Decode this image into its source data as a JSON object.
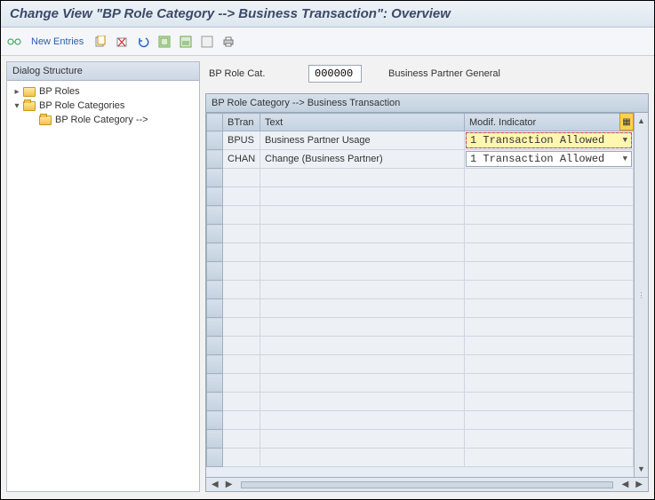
{
  "title": "Change View \"BP Role Category --> Business Transaction\": Overview",
  "toolbar": {
    "new_entries": "New Entries"
  },
  "sidebar": {
    "header": "Dialog Structure",
    "items": [
      {
        "label": "BP Roles",
        "indent": 0,
        "toggle": "▸",
        "open": false
      },
      {
        "label": "BP Role Categories",
        "indent": 0,
        "toggle": "▾",
        "open": true
      },
      {
        "label": "BP Role Category -->",
        "indent": 1,
        "toggle": "",
        "open": true
      }
    ]
  },
  "header_fields": {
    "role_cat_label": "BP Role Cat.",
    "role_cat_value": "000000",
    "role_cat_text": "Business Partner General"
  },
  "grid": {
    "title": "BP Role Category --> Business Transaction",
    "columns": {
      "btran": "BTran",
      "text": "Text",
      "modif": "Modif. Indicator"
    },
    "rows": [
      {
        "btran": "BPUS",
        "text": "Business Partner Usage",
        "modif": "1 Transaction Allowed",
        "highlight": true
      },
      {
        "btran": "CHAN",
        "text": "Change (Business Partner)",
        "modif": "1 Transaction Allowed",
        "highlight": false
      }
    ],
    "empty_rows": 16
  }
}
